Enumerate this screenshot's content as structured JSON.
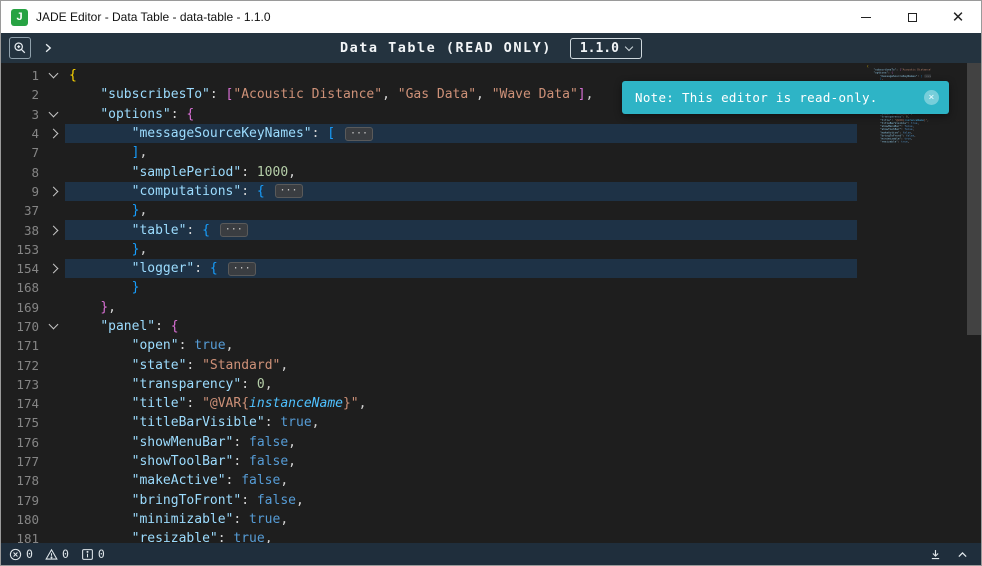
{
  "window": {
    "title": "JADE Editor - Data Table - data-table - 1.1.0",
    "logo_letter": "J"
  },
  "toolbar": {
    "title": "Data Table (READ ONLY)",
    "version": "1.1.0"
  },
  "toast": {
    "message": "Note: This editor is read-only.",
    "color": "#2eb4c6"
  },
  "status_bar": {
    "errors": "0",
    "warnings": "0",
    "infos": "0"
  },
  "colors": {
    "logo_green": "#27a343",
    "editor_background": "#1e1e1e",
    "fold_highlight": "rgba(30,80,130,0.40)"
  },
  "editor": {
    "lines": [
      {
        "n": "1",
        "f": "down",
        "tk": [
          {
            "c": "p1",
            "t": "{"
          }
        ]
      },
      {
        "n": "2",
        "tk": [
          {
            "c": "pn",
            "t": "    "
          },
          {
            "c": "key",
            "t": "\"subscribesTo\""
          },
          {
            "c": "pn",
            "t": ": "
          },
          {
            "c": "p2",
            "t": "["
          },
          {
            "c": "str",
            "t": "\"Acoustic Distance\""
          },
          {
            "c": "pn",
            "t": ", "
          },
          {
            "c": "str",
            "t": "\"Gas Data\""
          },
          {
            "c": "pn",
            "t": ", "
          },
          {
            "c": "str",
            "t": "\"Wave Data\""
          },
          {
            "c": "p2",
            "t": "]"
          },
          {
            "c": "pn",
            "t": ","
          }
        ]
      },
      {
        "n": "3",
        "f": "down",
        "tk": [
          {
            "c": "pn",
            "t": "    "
          },
          {
            "c": "key",
            "t": "\"options\""
          },
          {
            "c": "pn",
            "t": ": "
          },
          {
            "c": "p2",
            "t": "{"
          }
        ]
      },
      {
        "n": "4",
        "f": "right",
        "h": true,
        "tk": [
          {
            "c": "pn",
            "t": "        "
          },
          {
            "c": "key",
            "t": "\"messageSourceKeyNames\""
          },
          {
            "c": "pn",
            "t": ": "
          },
          {
            "c": "p3",
            "t": "["
          },
          {
            "c": "pn",
            "t": " "
          },
          {
            "c": "badge",
            "t": "···"
          }
        ]
      },
      {
        "n": "7",
        "tk": [
          {
            "c": "pn",
            "t": "        "
          },
          {
            "c": "p3",
            "t": "]"
          },
          {
            "c": "pn",
            "t": ","
          }
        ]
      },
      {
        "n": "8",
        "tk": [
          {
            "c": "pn",
            "t": "        "
          },
          {
            "c": "key",
            "t": "\"samplePeriod\""
          },
          {
            "c": "pn",
            "t": ": "
          },
          {
            "c": "num",
            "t": "1000"
          },
          {
            "c": "pn",
            "t": ","
          }
        ]
      },
      {
        "n": "9",
        "f": "right",
        "h": true,
        "tk": [
          {
            "c": "pn",
            "t": "        "
          },
          {
            "c": "key",
            "t": "\"computations\""
          },
          {
            "c": "pn",
            "t": ": "
          },
          {
            "c": "p3",
            "t": "{"
          },
          {
            "c": "pn",
            "t": " "
          },
          {
            "c": "badge",
            "t": "···"
          }
        ]
      },
      {
        "n": "37",
        "tk": [
          {
            "c": "pn",
            "t": "        "
          },
          {
            "c": "p3",
            "t": "}"
          },
          {
            "c": "pn",
            "t": ","
          }
        ]
      },
      {
        "n": "38",
        "f": "right",
        "h": true,
        "tk": [
          {
            "c": "pn",
            "t": "        "
          },
          {
            "c": "key",
            "t": "\"table\""
          },
          {
            "c": "pn",
            "t": ": "
          },
          {
            "c": "p3",
            "t": "{"
          },
          {
            "c": "pn",
            "t": " "
          },
          {
            "c": "badge",
            "t": "···"
          }
        ]
      },
      {
        "n": "153",
        "tk": [
          {
            "c": "pn",
            "t": "        "
          },
          {
            "c": "p3",
            "t": "}"
          },
          {
            "c": "pn",
            "t": ","
          }
        ]
      },
      {
        "n": "154",
        "f": "right",
        "h": true,
        "tk": [
          {
            "c": "pn",
            "t": "        "
          },
          {
            "c": "key",
            "t": "\"logger\""
          },
          {
            "c": "pn",
            "t": ": "
          },
          {
            "c": "p3",
            "t": "{"
          },
          {
            "c": "pn",
            "t": " "
          },
          {
            "c": "badge",
            "t": "···"
          }
        ]
      },
      {
        "n": "168",
        "tk": [
          {
            "c": "pn",
            "t": "        "
          },
          {
            "c": "p3",
            "t": "}"
          }
        ]
      },
      {
        "n": "169",
        "tk": [
          {
            "c": "pn",
            "t": "    "
          },
          {
            "c": "p2",
            "t": "}"
          },
          {
            "c": "pn",
            "t": ","
          }
        ]
      },
      {
        "n": "170",
        "f": "down",
        "tk": [
          {
            "c": "pn",
            "t": "    "
          },
          {
            "c": "key",
            "t": "\"panel\""
          },
          {
            "c": "pn",
            "t": ": "
          },
          {
            "c": "p2",
            "t": "{"
          }
        ]
      },
      {
        "n": "171",
        "tk": [
          {
            "c": "pn",
            "t": "        "
          },
          {
            "c": "key",
            "t": "\"open\""
          },
          {
            "c": "pn",
            "t": ": "
          },
          {
            "c": "bool",
            "t": "true"
          },
          {
            "c": "pn",
            "t": ","
          }
        ]
      },
      {
        "n": "172",
        "tk": [
          {
            "c": "pn",
            "t": "        "
          },
          {
            "c": "key",
            "t": "\"state\""
          },
          {
            "c": "pn",
            "t": ": "
          },
          {
            "c": "str",
            "t": "\"Standard\""
          },
          {
            "c": "pn",
            "t": ","
          }
        ]
      },
      {
        "n": "173",
        "tk": [
          {
            "c": "pn",
            "t": "        "
          },
          {
            "c": "key",
            "t": "\"transparency\""
          },
          {
            "c": "pn",
            "t": ": "
          },
          {
            "c": "num",
            "t": "0"
          },
          {
            "c": "pn",
            "t": ","
          }
        ]
      },
      {
        "n": "174",
        "tk": [
          {
            "c": "pn",
            "t": "        "
          },
          {
            "c": "key",
            "t": "\"title\""
          },
          {
            "c": "pn",
            "t": ": "
          },
          {
            "c": "str",
            "t": "\"@VAR{"
          },
          {
            "c": "var",
            "t": "instanceName"
          },
          {
            "c": "str",
            "t": "}\""
          },
          {
            "c": "pn",
            "t": ","
          }
        ]
      },
      {
        "n": "175",
        "tk": [
          {
            "c": "pn",
            "t": "        "
          },
          {
            "c": "key",
            "t": "\"titleBarVisible\""
          },
          {
            "c": "pn",
            "t": ": "
          },
          {
            "c": "bool",
            "t": "true"
          },
          {
            "c": "pn",
            "t": ","
          }
        ]
      },
      {
        "n": "176",
        "tk": [
          {
            "c": "pn",
            "t": "        "
          },
          {
            "c": "key",
            "t": "\"showMenuBar\""
          },
          {
            "c": "pn",
            "t": ": "
          },
          {
            "c": "bool",
            "t": "false"
          },
          {
            "c": "pn",
            "t": ","
          }
        ]
      },
      {
        "n": "177",
        "tk": [
          {
            "c": "pn",
            "t": "        "
          },
          {
            "c": "key",
            "t": "\"showToolBar\""
          },
          {
            "c": "pn",
            "t": ": "
          },
          {
            "c": "bool",
            "t": "false"
          },
          {
            "c": "pn",
            "t": ","
          }
        ]
      },
      {
        "n": "178",
        "tk": [
          {
            "c": "pn",
            "t": "        "
          },
          {
            "c": "key",
            "t": "\"makeActive\""
          },
          {
            "c": "pn",
            "t": ": "
          },
          {
            "c": "bool",
            "t": "false"
          },
          {
            "c": "pn",
            "t": ","
          }
        ]
      },
      {
        "n": "179",
        "tk": [
          {
            "c": "pn",
            "t": "        "
          },
          {
            "c": "key",
            "t": "\"bringToFront\""
          },
          {
            "c": "pn",
            "t": ": "
          },
          {
            "c": "bool",
            "t": "false"
          },
          {
            "c": "pn",
            "t": ","
          }
        ]
      },
      {
        "n": "180",
        "tk": [
          {
            "c": "pn",
            "t": "        "
          },
          {
            "c": "key",
            "t": "\"minimizable\""
          },
          {
            "c": "pn",
            "t": ": "
          },
          {
            "c": "bool",
            "t": "true"
          },
          {
            "c": "pn",
            "t": ","
          }
        ]
      },
      {
        "n": "181",
        "tk": [
          {
            "c": "pn",
            "t": "        "
          },
          {
            "c": "key",
            "t": "\"resizable\""
          },
          {
            "c": "pn",
            "t": ": "
          },
          {
            "c": "bool",
            "t": "true"
          },
          {
            "c": "pn",
            "t": ","
          }
        ]
      }
    ]
  }
}
